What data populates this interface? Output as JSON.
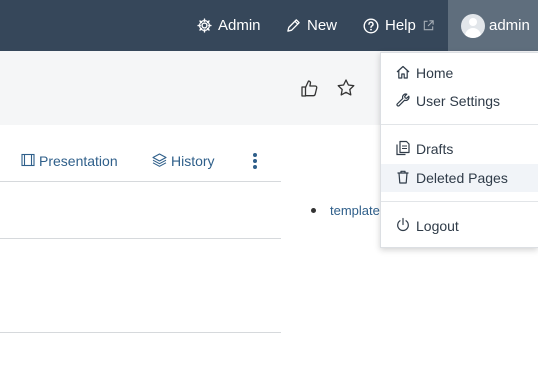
{
  "navbar": {
    "admin_label": "Admin",
    "new_label": "New",
    "help_label": "Help",
    "user_label": "admin"
  },
  "header": {
    "like_icon": "thumbs-up-icon",
    "favorite_icon": "star-icon"
  },
  "tabs": [
    {
      "label": "Presentation",
      "icon": "presentation-icon"
    },
    {
      "label": "History",
      "icon": "layers-icon"
    }
  ],
  "content": {
    "bullet_link": "template"
  },
  "user_menu": {
    "items": [
      {
        "label": "Home",
        "icon": "home-icon"
      },
      {
        "label": "User Settings",
        "icon": "wrench-icon"
      },
      {
        "label": "Drafts",
        "icon": "drafts-icon"
      },
      {
        "label": "Deleted Pages",
        "icon": "trash-icon"
      },
      {
        "label": "Logout",
        "icon": "power-icon"
      }
    ],
    "hovered": "Deleted Pages"
  },
  "colors": {
    "navbar_bg": "#36475a",
    "active_user_bg": "#5f6e7d",
    "link": "#2f5f8a"
  }
}
